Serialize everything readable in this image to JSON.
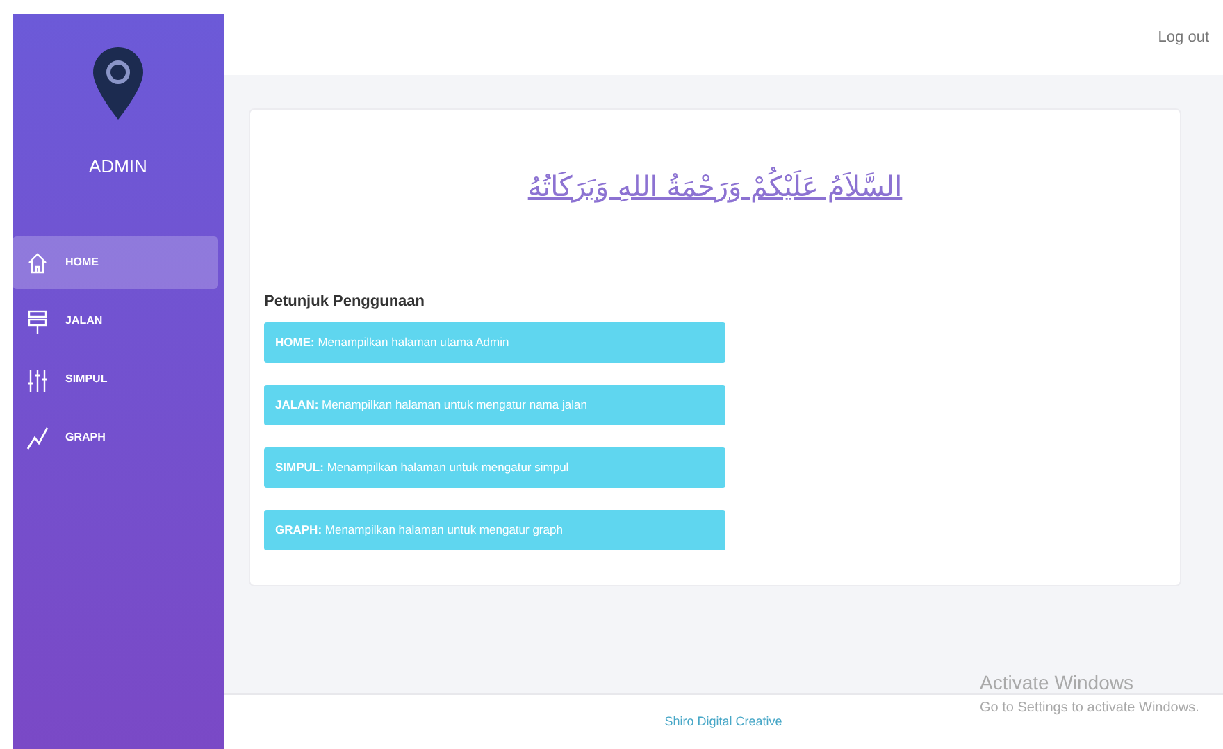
{
  "sidebar": {
    "title": "ADMIN",
    "items": [
      {
        "label": "HOME",
        "kind": "home",
        "selected": true
      },
      {
        "label": "JALAN",
        "kind": "signpost",
        "selected": false
      },
      {
        "label": "SIMPUL",
        "kind": "sliders",
        "selected": false
      },
      {
        "label": "GRAPH",
        "kind": "graph",
        "selected": false
      }
    ]
  },
  "topbar": {
    "logout": "Log out"
  },
  "greeting": "السَّلاَمُ عَلَيْكُمْ وَرَحْمَةُ اللهِ وَبَرَكَاتُهُ",
  "guide": {
    "title": "Petunjuk Penggunaan",
    "items": [
      {
        "text": "**HOME:** Menampilkan halaman utama Admin"
      },
      {
        "text": "**JALAN:** Menampilkan halaman untuk mengatur nama jalan"
      },
      {
        "text": "**SIMPUL:** Menampilkan halaman untuk mengatur simpul"
      },
      {
        "text": "**GRAPH:** Menampilkan halaman untuk mengatur graph"
      }
    ]
  },
  "footer": "Shiro Digital Creative",
  "os_notice": {
    "title": "Activate Windows",
    "subtitle": "Go to Settings to activate Windows."
  }
}
